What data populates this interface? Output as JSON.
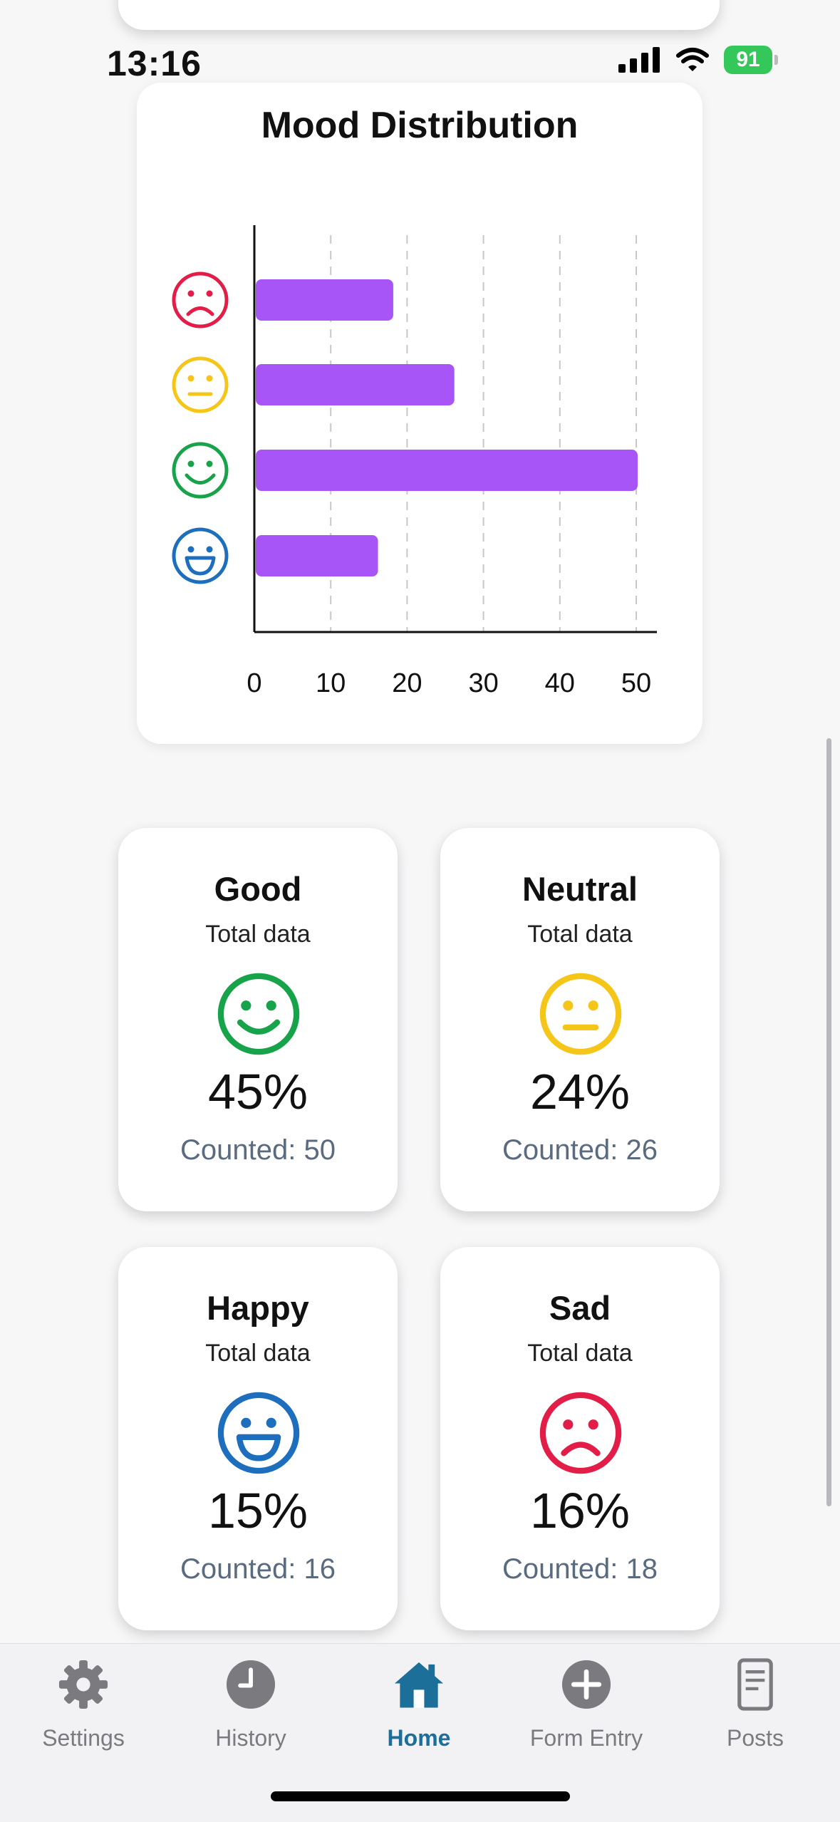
{
  "status_bar": {
    "time": "13:16",
    "battery": "91"
  },
  "chart": {
    "title": "Mood Distribution",
    "bar_color": "#a855f7"
  },
  "chart_data": {
    "type": "bar",
    "orientation": "horizontal",
    "title": "Mood Distribution",
    "categories": [
      "Sad",
      "Neutral",
      "Good",
      "Happy"
    ],
    "category_icons": [
      "sad-face-icon",
      "neutral-face-icon",
      "good-face-icon",
      "happy-face-icon"
    ],
    "category_colors": [
      "#e11d48",
      "#f5c518",
      "#16a34a",
      "#1d6fbd"
    ],
    "values": [
      18,
      26,
      50,
      16
    ],
    "xlim": [
      0,
      52
    ],
    "x_ticks": [
      "0",
      "10",
      "20",
      "30",
      "40",
      "50"
    ],
    "grid": "vertical dashed",
    "xlabel": "",
    "ylabel": ""
  },
  "stats": [
    {
      "title": "Good",
      "subtitle": "Total data",
      "icon": "good-face-icon",
      "color": "#16a34a",
      "percent": "45%",
      "count": "Counted: 50"
    },
    {
      "title": "Neutral",
      "subtitle": "Total data",
      "icon": "neutral-face-icon",
      "color": "#f5c518",
      "percent": "24%",
      "count": "Counted: 26"
    },
    {
      "title": "Happy",
      "subtitle": "Total data",
      "icon": "happy-face-icon",
      "color": "#1d6fbd",
      "percent": "15%",
      "count": "Counted: 16"
    },
    {
      "title": "Sad",
      "subtitle": "Total data",
      "icon": "sad-face-icon",
      "color": "#e11d48",
      "percent": "16%",
      "count": "Counted: 18"
    }
  ],
  "tabs": [
    {
      "label": "Settings",
      "icon": "gear-icon",
      "active": false
    },
    {
      "label": "History",
      "icon": "clock-icon",
      "active": false
    },
    {
      "label": "Home",
      "icon": "house-icon",
      "active": true
    },
    {
      "label": "Form Entry",
      "icon": "plus-circle-icon",
      "active": false
    },
    {
      "label": "Posts",
      "icon": "document-icon",
      "active": false
    }
  ],
  "colors": {
    "active_tab": "#1c6f99",
    "inactive_tab": "#7a7a7f"
  }
}
